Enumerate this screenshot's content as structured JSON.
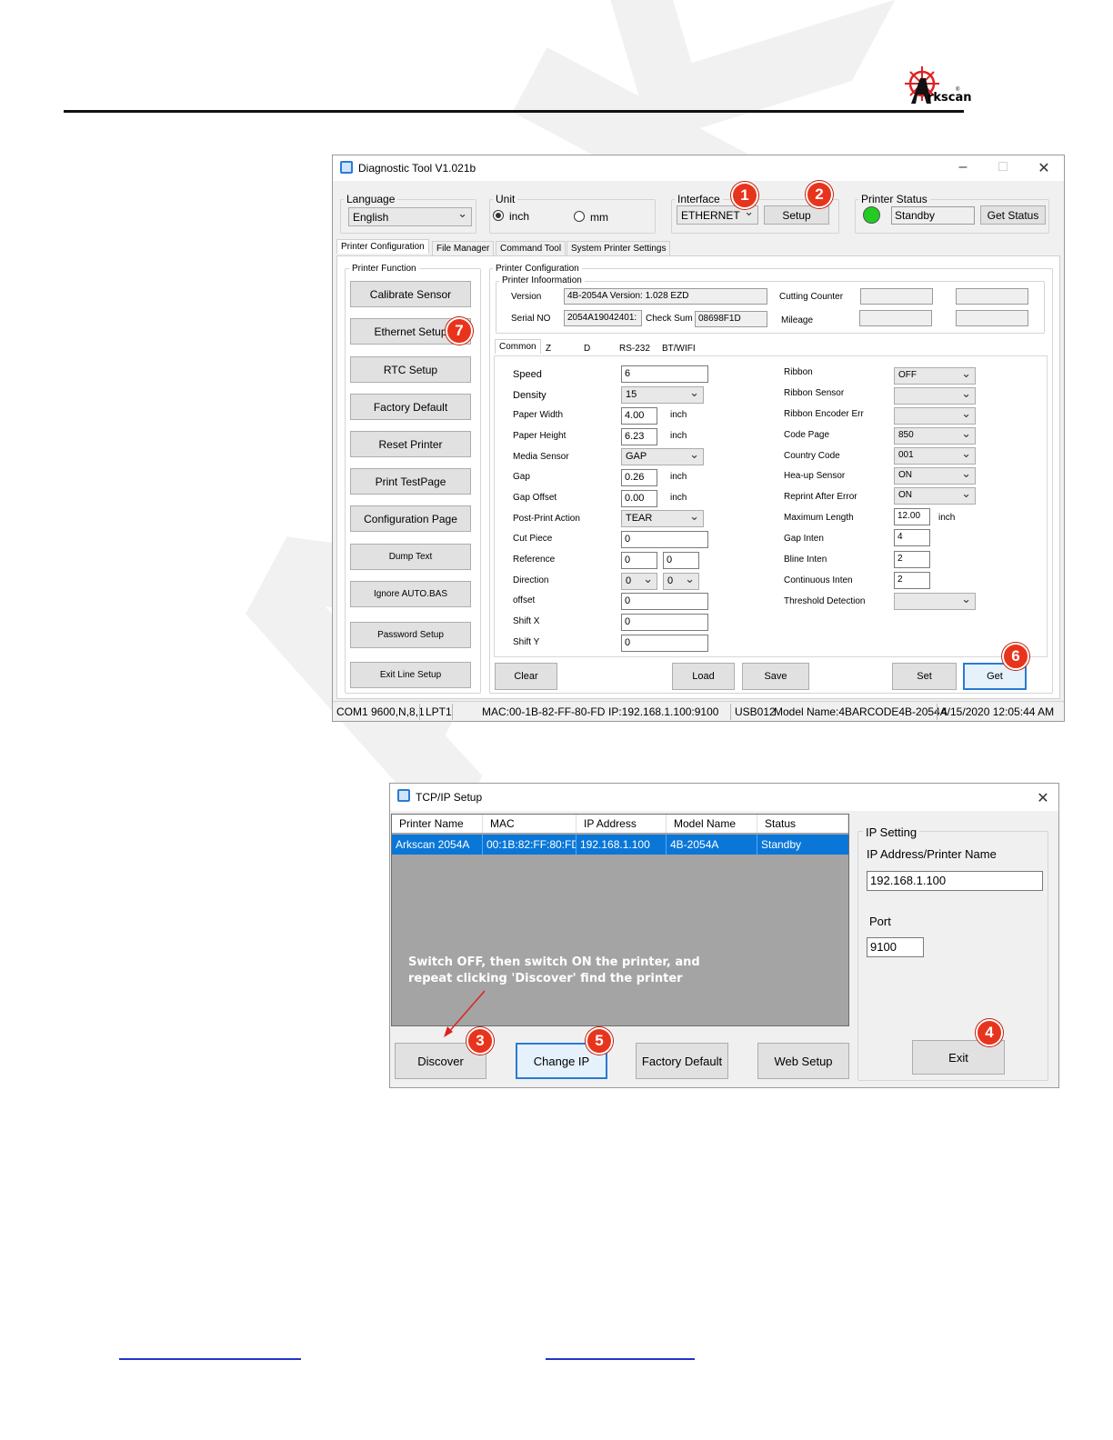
{
  "brand": {
    "name": "rkscan",
    "initial": "A",
    "registered": "®"
  },
  "watermark": "ARKSCAN",
  "diag": {
    "title": "Diagnostic Tool V1.021b",
    "language": {
      "label": "Language",
      "value": "English"
    },
    "unit": {
      "label": "Unit",
      "inch": "inch",
      "mm": "mm"
    },
    "interface": {
      "label": "Interface",
      "value": "ETHERNET",
      "setup": "Setup"
    },
    "printer_status": {
      "label": "Printer  Status",
      "value": "Standby",
      "get_status": "Get Status",
      "light_color": "#22cc22"
    },
    "tabs": [
      "Printer Configuration",
      "File Manager",
      "Command Tool",
      "System Printer Settings"
    ],
    "function": {
      "label": "Printer  Function",
      "buttons": [
        "Calibrate Sensor",
        "Ethernet Setup",
        "RTC Setup",
        "Factory Default",
        "Reset Printer",
        "Print TestPage",
        "Configuration Page",
        "Dump Text",
        "Ignore AUTO.BAS",
        "Password Setup",
        "Exit Line Setup"
      ]
    },
    "config": {
      "label": "Printer Configuration",
      "info_label": "Printer Infoormation",
      "version_label": "Version",
      "version": "4B-2054A Version: 1.028 EZD",
      "serial_label": "Serial NO",
      "serial": "2054A19042401:",
      "checksum_label": "Check Sum",
      "checksum": "08698F1D",
      "cutting_label": "Cutting Counter",
      "mileage_label": "Mileage",
      "subtabs": [
        "Common",
        "Z",
        "D",
        "RS-232",
        "BT/WIFI"
      ],
      "left": {
        "speed": {
          "label": "Speed",
          "value": "6"
        },
        "density": {
          "label": "Density",
          "value": "15"
        },
        "paper_width": {
          "label": "Paper Width",
          "value": "4.00",
          "unit": "inch"
        },
        "paper_height": {
          "label": "Paper Height",
          "value": "6.23",
          "unit": "inch"
        },
        "media_sensor": {
          "label": "Media Sensor",
          "value": "GAP"
        },
        "gap": {
          "label": "Gap",
          "value": "0.26",
          "unit": "inch"
        },
        "gap_offset": {
          "label": "Gap Offset",
          "value": "0.00",
          "unit": "inch"
        },
        "post_print": {
          "label": "Post-Print  Action",
          "value": "TEAR"
        },
        "cut_piece": {
          "label": "Cut  Piece",
          "value": "0"
        },
        "reference": {
          "label": "Reference",
          "x": "0",
          "y": "0"
        },
        "direction": {
          "label": "Direction",
          "a": "0",
          "b": "0"
        },
        "offset": {
          "label": "offset",
          "value": "0"
        },
        "shift_x": {
          "label": "Shift X",
          "value": "0"
        },
        "shift_y": {
          "label": "Shift Y",
          "value": "0"
        }
      },
      "right": {
        "ribbon": {
          "label": "Ribbon",
          "value": "OFF"
        },
        "ribbon_sensor": {
          "label": "Ribbon  Sensor"
        },
        "ribbon_encoder": {
          "label": "Ribbon Encoder Err"
        },
        "code_page": {
          "label": "Code Page",
          "value": "850"
        },
        "country_code": {
          "label": "Country Code",
          "value": "001"
        },
        "head_up": {
          "label": "Hea-up  Sensor",
          "value": "ON"
        },
        "reprint": {
          "label": "Reprint After  Error",
          "value": "ON"
        },
        "max_length": {
          "label": "Maximum Length",
          "value": "12.00",
          "unit": "inch"
        },
        "gap_inten": {
          "label": "Gap Inten",
          "value": "4"
        },
        "bline_inten": {
          "label": "Bline  Inten",
          "value": "2"
        },
        "continuous_inten": {
          "label": "Continuous  Inten",
          "value": "2"
        },
        "threshold": {
          "label": "Threshold  Detection"
        }
      },
      "buttons": {
        "clear": "Clear",
        "load": "Load",
        "save": "Save",
        "set": "Set",
        "get": "Get"
      }
    },
    "statusbar": [
      "COM1 9600,N,8,1",
      "LPT1",
      "MAC:00-1B-82-FF-80-FD",
      "IP:192.168.1.100:9100",
      "USB012",
      "Model Name:4BARCODE4B-2054A",
      "4/15/2020 12:05:44 AM"
    ]
  },
  "tcp": {
    "title": "TCP/IP Setup",
    "columns": [
      "Printer Name",
      "MAC",
      "IP Address",
      "Model Name",
      "Status"
    ],
    "rows": [
      [
        "Arkscan 2054A",
        "00:1B:82:FF:80:FD",
        "192.168.1.100",
        "4B-2054A",
        "Standby"
      ]
    ],
    "note_line1": "Switch OFF, then switch ON the printer, and",
    "note_line2": "repeat clicking 'Discover' find the printer",
    "ip_setting_label": "IP Setting",
    "ip_label": "IP Address/Printer Name",
    "ip_value": "192.168.1.100",
    "port_label": "Port",
    "port_value": "9100",
    "buttons": {
      "discover": "Discover",
      "change_ip": "Change IP",
      "factory_default": "Factory Default",
      "web_setup": "Web Setup",
      "exit": "Exit"
    }
  },
  "badges": [
    "1",
    "2",
    "3",
    "4",
    "5",
    "6",
    "7"
  ]
}
